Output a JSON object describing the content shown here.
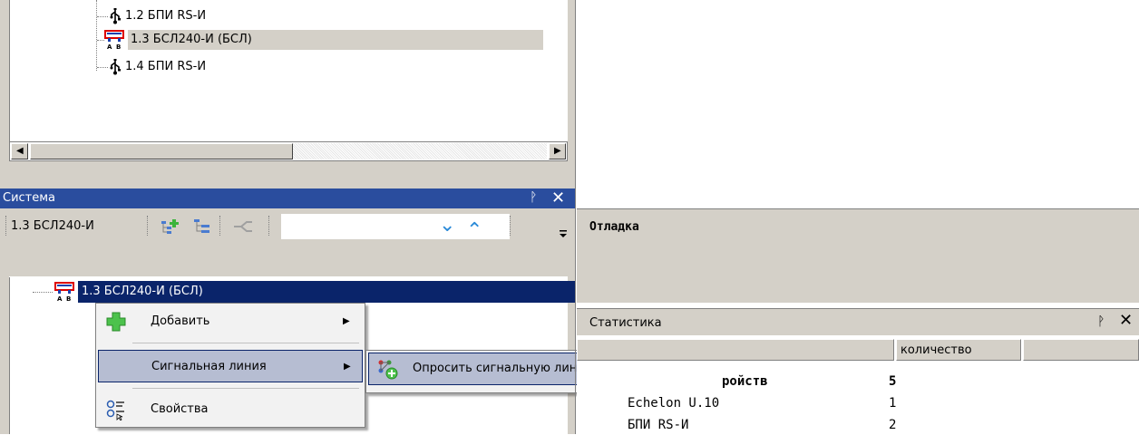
{
  "top_tree": {
    "items": [
      {
        "label": "1.2 БПИ RS-И",
        "icon": "usb-icon"
      },
      {
        "label": "1.3 БСЛ240-И (БСЛ)",
        "icon": "bsl-device-icon"
      },
      {
        "label": "1.4 БПИ RS-И",
        "icon": "usb-icon"
      }
    ]
  },
  "system_panel": {
    "title": "Система",
    "pin_glyph": "ᚹ",
    "close_glyph": "✕",
    "toolbar": {
      "crumb": "1.3 БСЛ240-И",
      "down_glyph": "⌄",
      "up_glyph": "⌃"
    },
    "tree": {
      "selected_item": "1.3 БСЛ240-И (БСЛ)"
    }
  },
  "context_menu": {
    "items": [
      {
        "label": "Добавить",
        "icon": "add-icon",
        "has_submenu": true
      },
      {
        "label": "Сигнальная линия",
        "icon": "",
        "has_submenu": true
      },
      {
        "label": "Свойства",
        "icon": "properties-icon",
        "has_submenu": false
      }
    ],
    "submenu": {
      "label": "Опросить сигнальную линию",
      "icon": "poll-line-icon"
    },
    "arrow_glyph": "▶"
  },
  "debug_panel": {
    "title": "Отладка"
  },
  "stats_panel": {
    "title": "Статистика",
    "pin_glyph": "ᚹ",
    "close_glyph": "✕",
    "columns": [
      "",
      "количество",
      ""
    ],
    "rows": [
      {
        "name": "ройств",
        "value": "5",
        "bold": true
      },
      {
        "name": "Echelon U.10",
        "value": "1",
        "bold": false
      },
      {
        "name": "БПИ RS-И",
        "value": "2",
        "bold": false
      }
    ]
  },
  "colors": {
    "panel_bg": "#d4d0c8",
    "title_blue": "#2a4d9e",
    "selection_navy": "#0a246a",
    "menu_highlight": "#b6bdd2"
  }
}
